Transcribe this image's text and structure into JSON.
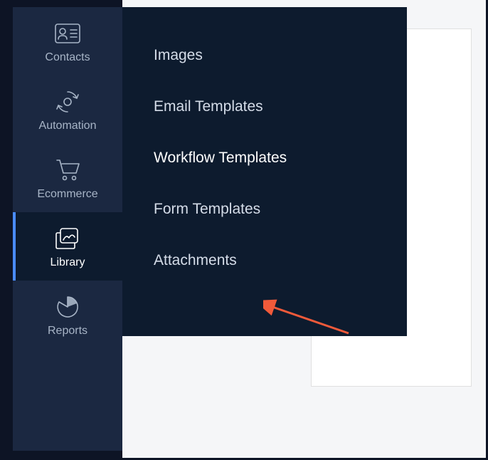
{
  "sidebar": {
    "items": [
      {
        "label": "Contacts"
      },
      {
        "label": "Automation"
      },
      {
        "label": "Ecommerce"
      },
      {
        "label": "Library"
      },
      {
        "label": "Reports"
      }
    ]
  },
  "flyout": {
    "items": [
      {
        "label": "Images"
      },
      {
        "label": "Email Templates"
      },
      {
        "label": "Workflow Templates"
      },
      {
        "label": "Form Templates"
      },
      {
        "label": "Attachments"
      }
    ]
  }
}
